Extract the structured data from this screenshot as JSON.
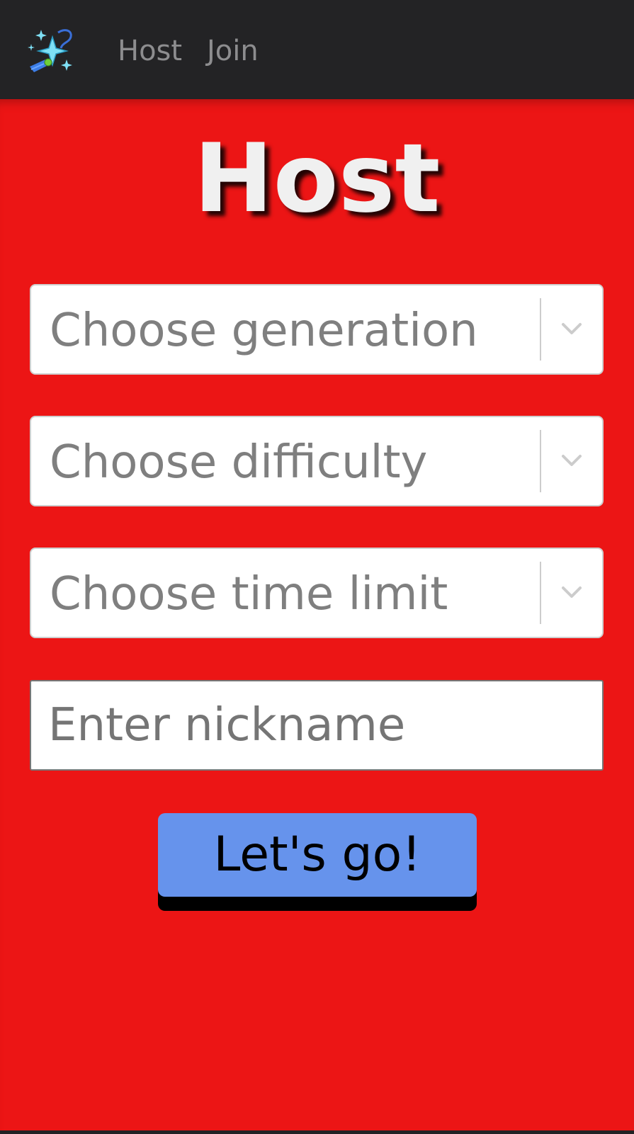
{
  "navbar": {
    "logo_icon": "sparkles-comet-icon",
    "links": [
      {
        "label": "Host"
      },
      {
        "label": "Join"
      }
    ]
  },
  "main": {
    "title": "Host",
    "selects": [
      {
        "placeholder": "Choose generation"
      },
      {
        "placeholder": "Choose difficulty"
      },
      {
        "placeholder": "Choose time limit"
      }
    ],
    "nickname": {
      "placeholder": "Enter nickname",
      "value": ""
    },
    "submit_label": "Let's go!"
  },
  "colors": {
    "navbar_bg": "#232325",
    "page_bg": "#ec1515",
    "button_bg": "#6693ec",
    "nav_link": "#8d8d8f",
    "title": "#f0f0f0"
  }
}
